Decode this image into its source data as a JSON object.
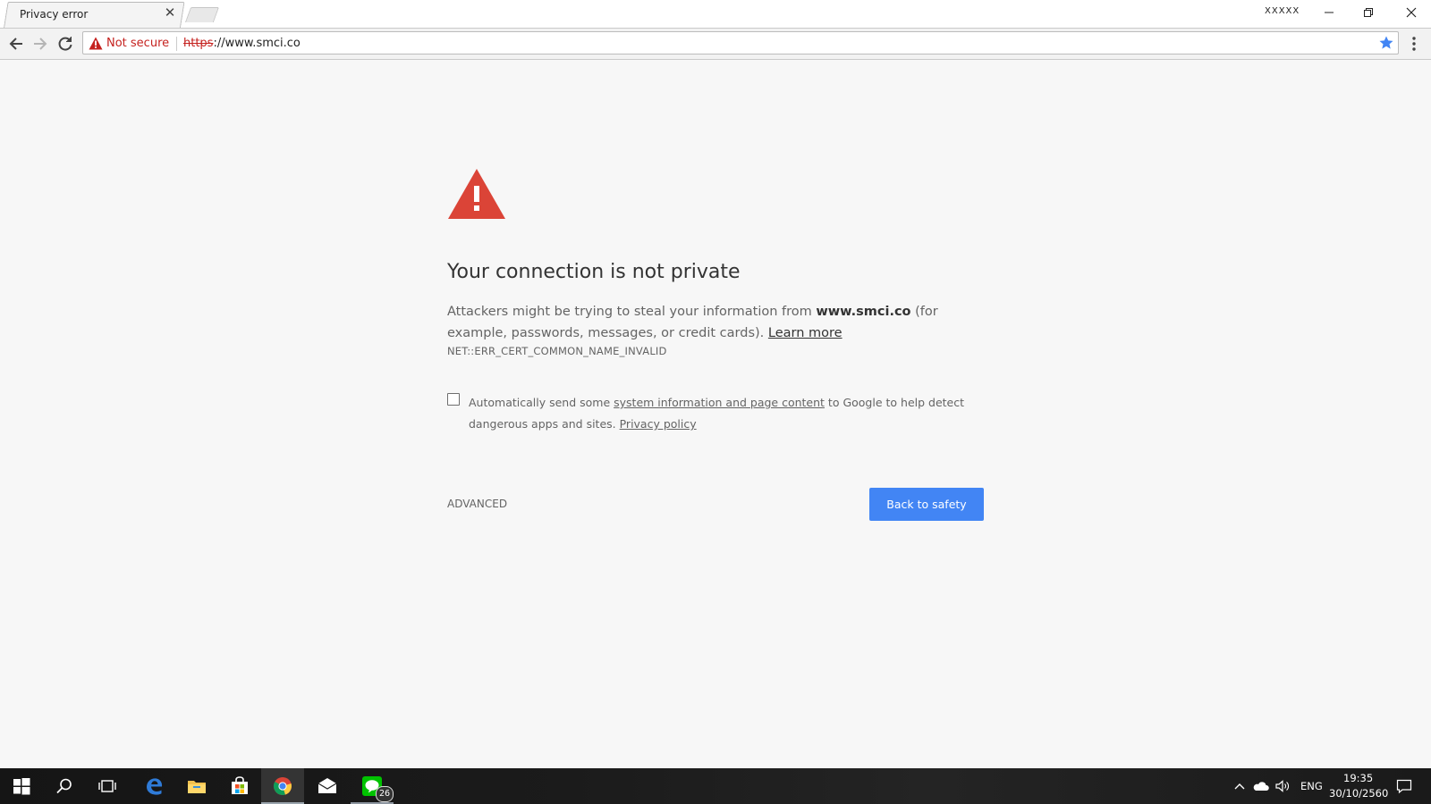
{
  "tab": {
    "title": "Privacy error"
  },
  "window": {
    "profile_label": "XXXXX"
  },
  "omnibox": {
    "security_label": "Not secure",
    "url_scheme": "https",
    "url_rest": "://www.smci.co"
  },
  "interstitial": {
    "heading": "Your connection is not private",
    "explain_pre": "Attackers might be trying to steal your information from ",
    "domain": "www.smci.co",
    "explain_post": " (for example, passwords, messages, or credit cards). ",
    "learn_more": "Learn more",
    "error_code": "NET::ERR_CERT_COMMON_NAME_INVALID",
    "optin_pre": "Automatically send some ",
    "optin_link": "system information and page content",
    "optin_post": " to Google to help detect dangerous apps and sites. ",
    "privacy_policy": "Privacy policy",
    "advanced_label": "ADVANCED",
    "back_button_label": "Back to safety"
  },
  "taskbar": {
    "line_badge": "26",
    "language": "ENG",
    "time": "19:35",
    "date": "30/10/2560"
  },
  "colors": {
    "accent_blue": "#4285f4",
    "warning_red": "#db4437",
    "insecure_red": "#c5221f"
  }
}
